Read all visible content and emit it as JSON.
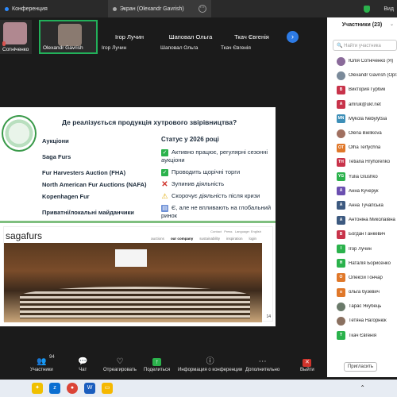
{
  "tabs": [
    {
      "label": "Конференция"
    },
    {
      "label": "Экран (Olexandr Gavrish)"
    }
  ],
  "topbar_right": "Вид",
  "thumbnails": [
    {
      "name": "Сотніченко",
      "muted": false
    },
    {
      "name": "Olexandr Gavrish",
      "muted": false,
      "active": true
    }
  ],
  "participant_tiles": [
    {
      "name": "Ігор Лучин",
      "sub": "Ігор Лучин"
    },
    {
      "name": "Шаповал Ольга",
      "sub": "Шаповал Ольга"
    },
    {
      "name": "Ткач Євгенія",
      "sub": "Ткач Євгенія"
    }
  ],
  "slide": {
    "heading": "Де реалізується продукція хутрового звірівництва?",
    "left_header": "Аукціони",
    "right_header": "Статус у 2026 році",
    "rows": [
      {
        "left": "Saga Furs",
        "right": "Активно працює, регулярні сезонні аукціони",
        "icon": "check-icon"
      },
      {
        "left": "Fur Harvesters Auction (FHA)",
        "right": "Проводить щорічні торги",
        "icon": "check-icon"
      },
      {
        "left": "North American Fur Auctions (NAFA)",
        "right": "Зупинив діяльність",
        "icon": "cross-icon"
      },
      {
        "left": "Kopenhagen Fur",
        "right": "Скорочує діяльність після кризи",
        "icon": "warning-icon"
      },
      {
        "left": "Приватні/локальні майданчики",
        "right": "Є, але не впливають на глобальний ринок",
        "icon": "chart-icon"
      }
    ],
    "website": {
      "brand": "sagafurs",
      "top_links": [
        "Contact",
        "Press",
        "Language: English"
      ],
      "nav": [
        "auctions",
        "our company",
        "sustainability",
        "inspiration",
        "login"
      ],
      "page_number": "14"
    }
  },
  "panel": {
    "title": "Участники",
    "count_label": "(23)",
    "search_placeholder": "Найти участника",
    "participants": [
      {
        "name": "Юлія Сотніченко (Я)",
        "initials": "",
        "color": "#8a6a9a",
        "photo": true
      },
      {
        "name": "Olexandr Gavrish (Организатор)",
        "initials": "",
        "color": "#7a8a9a",
        "photo": true
      },
      {
        "name": "Виктория Гурбик",
        "initials": "B",
        "color": "#c8334a"
      },
      {
        "name": "amruk@ukr.net",
        "initials": "A",
        "color": "#c8334a"
      },
      {
        "name": "Mykola Nebylytsia",
        "initials": "MN",
        "color": "#3d8fb8"
      },
      {
        "name": "Olena Bielikova",
        "initials": "",
        "color": "#a07060",
        "photo": true
      },
      {
        "name": "Olha Tertychna",
        "initials": "OT",
        "color": "#e0782a"
      },
      {
        "name": "Tetiana Hryhorenko",
        "initials": "TH",
        "color": "#c8334a"
      },
      {
        "name": "Yulia Glushko",
        "initials": "YG",
        "color": "#2bb24c"
      },
      {
        "name": "Анна Кучерук",
        "initials": "A",
        "color": "#6b4fb0"
      },
      {
        "name": "Анна Тучапська",
        "initials": "A",
        "color": "#3d5a80"
      },
      {
        "name": "Антоніна Миколаївна",
        "initials": "A",
        "color": "#3d5a80"
      },
      {
        "name": "Богдан Ганкевич",
        "initials": "B",
        "color": "#c8334a"
      },
      {
        "name": "Ігор Лучин",
        "initials": "I",
        "color": "#2bb24c"
      },
      {
        "name": "Наталія Борисенко",
        "initials": "H",
        "color": "#2bb24c"
      },
      {
        "name": "Олексій Гончар",
        "initials": "O",
        "color": "#e0782a"
      },
      {
        "name": "ольга бузевич",
        "initials": "o",
        "color": "#e0782a"
      },
      {
        "name": "Тарас Якубець",
        "initials": "",
        "color": "#6a7a6a",
        "photo": true
      },
      {
        "name": "Тетяна Нагорнюк",
        "initials": "",
        "color": "#8a7060",
        "photo": true
      },
      {
        "name": "Ткач Євгенія",
        "initials": "T",
        "color": "#2bb24c"
      }
    ],
    "invite_label": "Пригласить"
  },
  "toolbar": {
    "participants_label": "Участники",
    "participants_count": "94",
    "chat_label": "Чат",
    "react_label": "Отреагировать",
    "share_label": "Поделиться",
    "info_label": "Информация о конференции",
    "more_label": "Дополнительно",
    "leave_label": "Выйти"
  }
}
